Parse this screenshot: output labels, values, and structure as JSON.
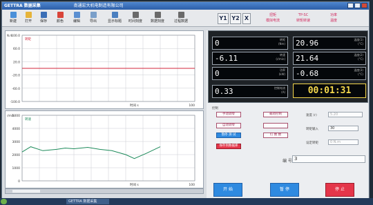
{
  "window": {
    "title_brand": "GETTRA 数据采集",
    "title_company": "南通宏大机电制造有限公司"
  },
  "toolbar": {
    "items": [
      {
        "label": "新建",
        "icon": "new-file-icon",
        "color": "#4a90d9"
      },
      {
        "label": "打开",
        "icon": "folder-open-icon",
        "color": "#e6b43a"
      },
      {
        "label": "保存",
        "icon": "save-icon",
        "color": "#3b6fb6"
      },
      {
        "label": "颜色",
        "icon": "palette-icon",
        "color": "#d9453a"
      },
      {
        "label": "编辑",
        "icon": "edit-icon",
        "color": "#5a8fd1"
      },
      {
        "label": "导出",
        "icon": "export-icon",
        "color": "#7a9fc9"
      },
      {
        "label": "显示标题",
        "icon": "title-icon",
        "color": "#4a7fc0"
      },
      {
        "label": "时间刻度",
        "icon": "time-scale-icon",
        "color": "#6a6a6a"
      },
      {
        "label": "数据刻度",
        "icon": "data-scale-icon",
        "color": "#6a6a6a"
      },
      {
        "label": "过程数据",
        "icon": "process-data-icon",
        "color": "#6a6a6a"
      }
    ],
    "axis_buttons": [
      "Y1",
      "Y2",
      "X"
    ],
    "mode_buttons": [
      {
        "line1": "扭矩",
        "line2": "模拟电流"
      },
      {
        "line1": "TP-SC",
        "line2": "转矩转速"
      },
      {
        "line1": "功率",
        "line2": "温度"
      }
    ]
  },
  "chart_top": {
    "legend": "转矩",
    "y_unit": "N.m",
    "y_ticks": [
      "100.0",
      "60.0",
      "20.0",
      "-20.0",
      "-60.0",
      "-100.0"
    ],
    "x_label": "时间 s",
    "x_end": "100"
  },
  "chart_bottom": {
    "legend": "转速",
    "y_unit": "r/min",
    "y_ticks": [
      "5000",
      "4000",
      "3000",
      "2000",
      "1000",
      "0"
    ],
    "x_label": "时间 s",
    "x_end": "100"
  },
  "readouts": [
    {
      "value": "0",
      "unit_line1": "转矩",
      "unit_line2": "(Nm)"
    },
    {
      "value": "20.96",
      "unit_line1": "温度(1)",
      "unit_line2": "(°C)"
    },
    {
      "value": "-6.11",
      "unit_line1": "转速",
      "unit_line2": "(r/min)"
    },
    {
      "value": "21.64",
      "unit_line1": "温度(2)",
      "unit_line2": "(°C)"
    },
    {
      "value": "0",
      "unit_line1": "功率",
      "unit_line2": "(kW)"
    },
    {
      "value": "-0.68",
      "unit_line1": "温度(3)",
      "unit_line2": "(°C)"
    },
    {
      "value": "0.33",
      "unit_line1": "控制电流",
      "unit_line2": "(A)"
    }
  ],
  "timer": "00:01:31",
  "controls": {
    "section_label": "控制",
    "buttons_left": [
      "手动调零",
      "自动调零",
      "暂停 测 试",
      "保存到数据库"
    ],
    "buttons_mid": [
      "载荷控制",
      "",
      "打 数 数"
    ],
    "speed_label": "速度 (r)",
    "speed_value": "5.20",
    "torque_set_label": "转矩输入",
    "torque_set_value": "30",
    "fixed_torque_label": "设定转矩",
    "fixed_torque_value": "0 N.m",
    "serial_label": "编  号",
    "serial_value": "3"
  },
  "bottom_buttons": {
    "start": "开 始",
    "pause": "暂 停",
    "stop": "停 止"
  },
  "taskbar": {
    "task_label": "GETTRA 数据采集"
  },
  "chart_data": [
    {
      "type": "line",
      "title": "转矩",
      "xlabel": "时间 s",
      "ylabel": "N.m",
      "xlim": [
        0,
        100
      ],
      "ylim": [
        -100,
        100
      ],
      "series": [
        {
          "name": "转矩",
          "x": [
            0,
            100
          ],
          "y": [
            0,
            0
          ]
        }
      ]
    },
    {
      "type": "line",
      "title": "转速",
      "xlabel": "时间 s",
      "ylabel": "r/min",
      "xlim": [
        0,
        100
      ],
      "ylim": [
        0,
        5000
      ],
      "series": [
        {
          "name": "转速",
          "x": [
            0,
            5,
            12,
            20,
            25,
            30,
            38,
            45,
            52,
            60,
            65,
            72,
            80
          ],
          "y": [
            2200,
            2600,
            2300,
            2400,
            2500,
            2450,
            2550,
            2400,
            2300,
            2000,
            1700,
            2100,
            2600
          ]
        }
      ]
    }
  ]
}
